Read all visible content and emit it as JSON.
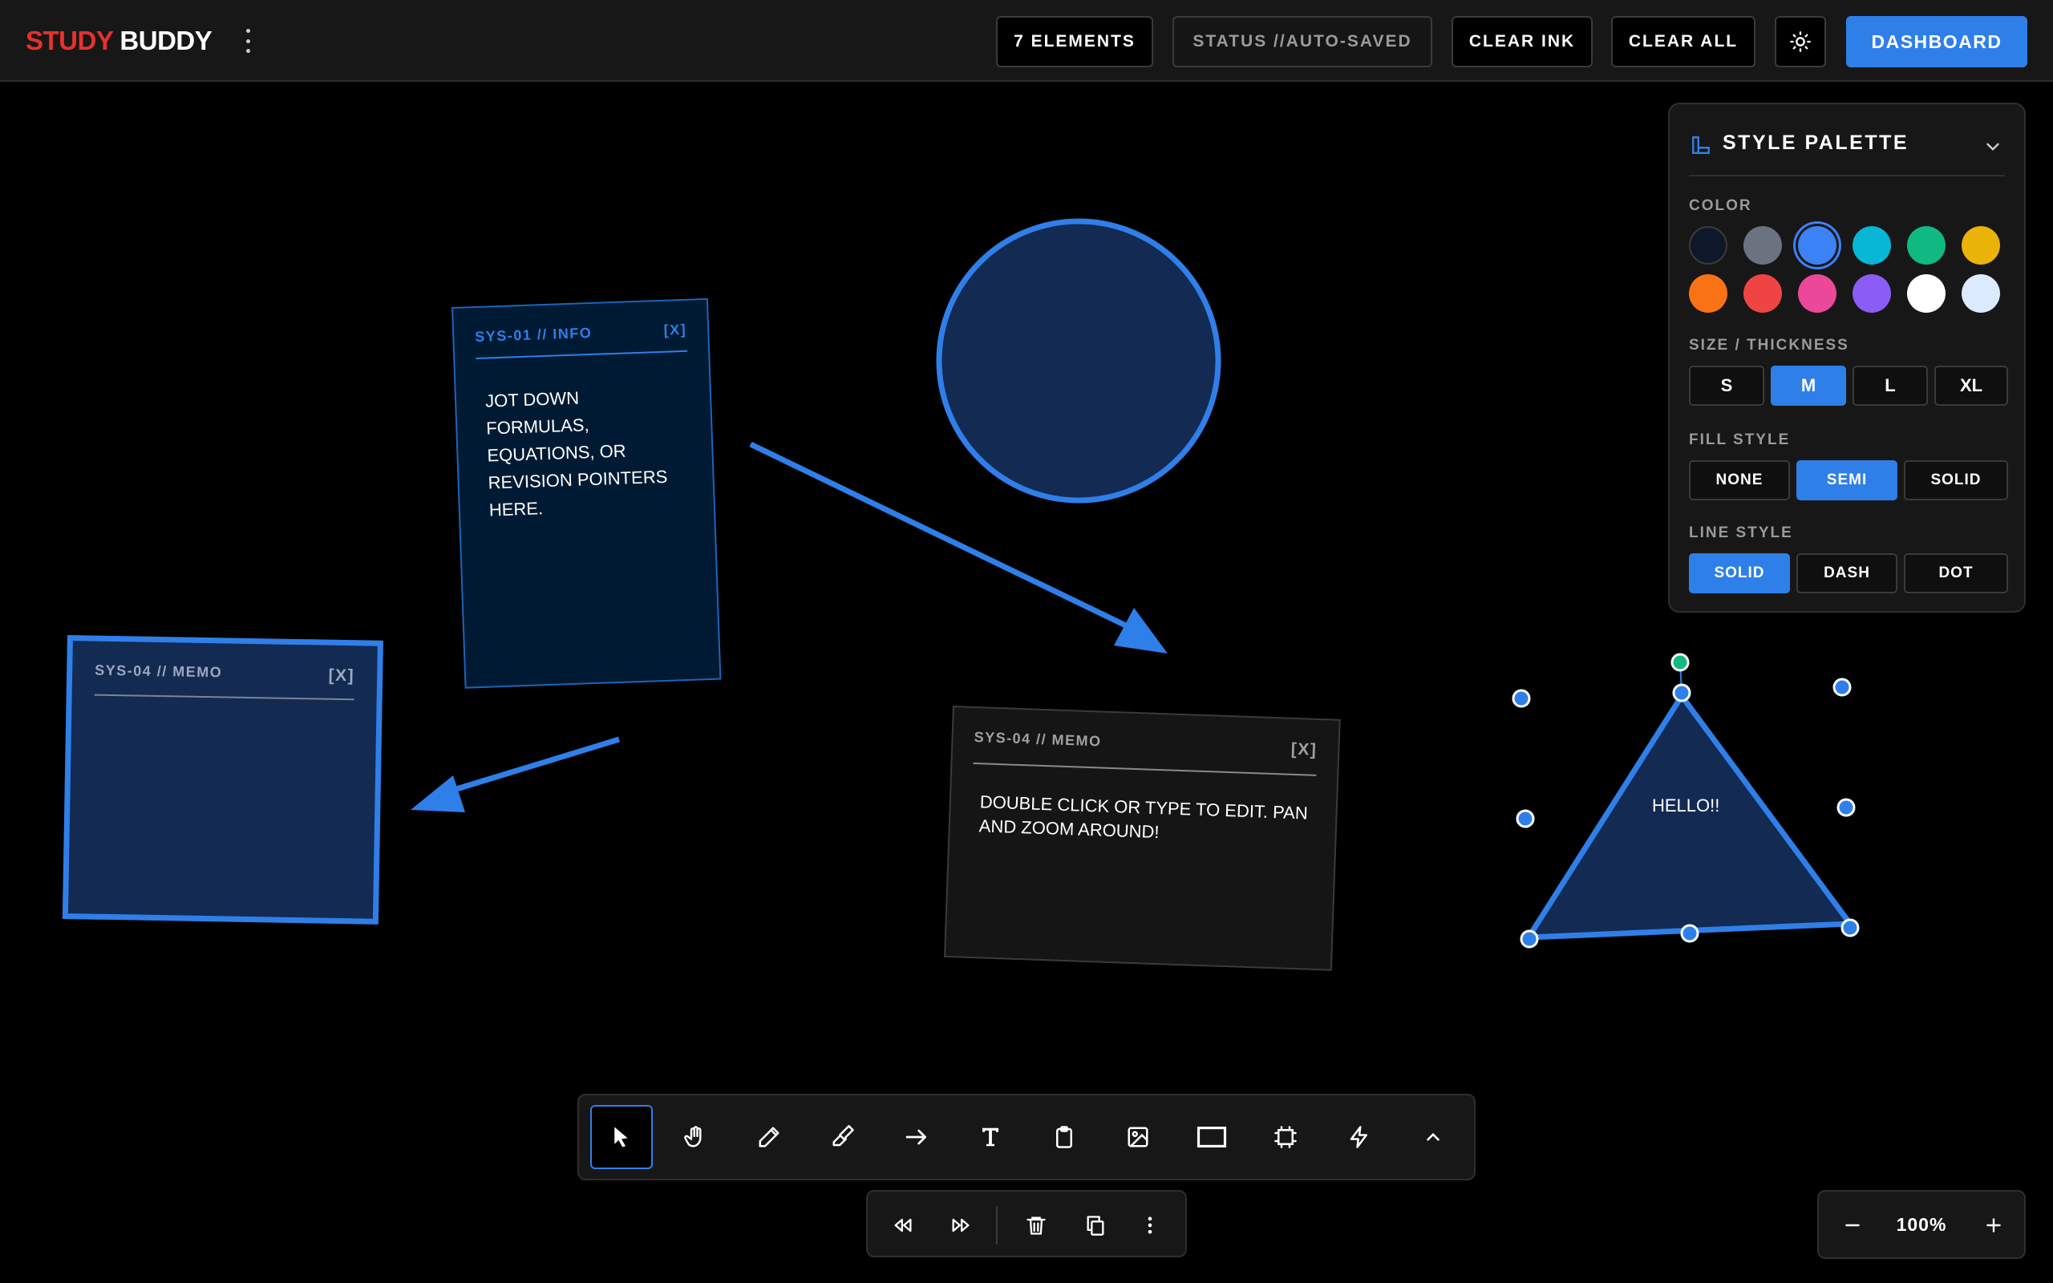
{
  "app": {
    "logo_part1": "STUDY",
    "logo_part2": "BUDDY"
  },
  "header": {
    "elements_count": "7 ELEMENTS",
    "status": "STATUS //AUTO-SAVED",
    "clear_ink": "CLEAR INK",
    "clear_all": "CLEAR ALL",
    "dashboard": "DASHBOARD"
  },
  "canvas": {
    "note_info": {
      "title": "SYS-01 // INFO",
      "close": "[X]",
      "body": "JOT DOWN FORMULAS, EQUATIONS, OR REVISION POINTERS HERE."
    },
    "note_memo_left": {
      "title": "SYS-04 // MEMO",
      "close": "[X]"
    },
    "note_memo_center": {
      "title": "SYS-04 // MEMO",
      "close": "[X]",
      "body": "DOUBLE CLICK OR TYPE TO EDIT. PAN AND ZOOM AROUND!"
    },
    "triangle_label": "HELLO!!",
    "accent": "#2f7fe9",
    "shape_fill": "#132a52"
  },
  "palette": {
    "title": "STYLE PALETTE",
    "color_label": "COLOR",
    "colors": [
      "#0f172a",
      "#6b7280",
      "#3b82f6",
      "#06b6d4",
      "#10b981",
      "#eab308",
      "#f97316",
      "#ef4444",
      "#ec4899",
      "#8b5cf6",
      "#ffffff",
      "#dbeafe"
    ],
    "selected_color": "#3b82f6",
    "size_label": "SIZE / THICKNESS",
    "sizes": [
      "S",
      "M",
      "L",
      "XL"
    ],
    "selected_size": "M",
    "fill_label": "FILL STYLE",
    "fills": [
      "NONE",
      "SEMI",
      "SOLID"
    ],
    "selected_fill": "SEMI",
    "line_label": "LINE STYLE",
    "lines": [
      "SOLID",
      "DASH",
      "DOT"
    ],
    "selected_line": "SOLID"
  },
  "toolbar": {
    "tools": [
      "select-icon",
      "hand-icon",
      "pencil-icon",
      "highlighter-icon",
      "arrow-icon",
      "text-icon",
      "clipboard-icon",
      "image-icon",
      "rectangle-icon",
      "frame-icon",
      "lightning-icon",
      "chevron-up-icon"
    ],
    "active_tool": "select-icon"
  },
  "actions": [
    "undo-icon",
    "redo-icon",
    "trash-icon",
    "copy-icon",
    "more-icon"
  ],
  "zoom": {
    "value": "100%"
  }
}
